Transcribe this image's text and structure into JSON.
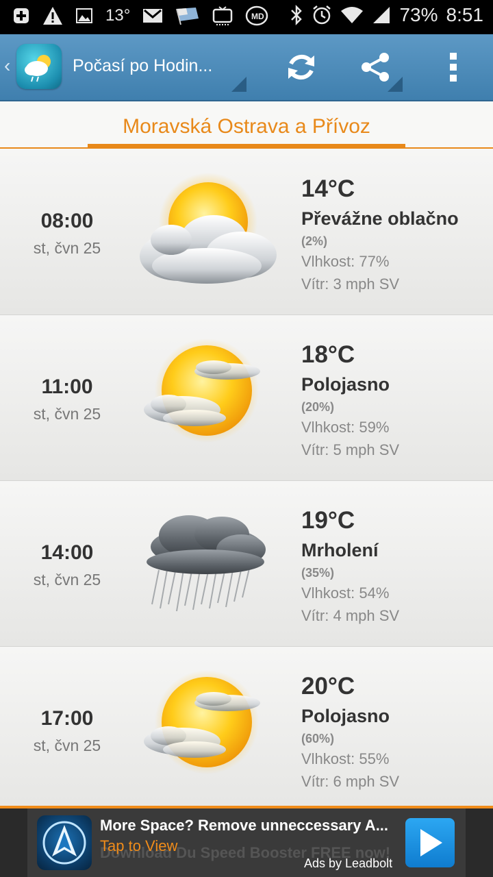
{
  "status_bar": {
    "left_icons": [
      "add-box-icon",
      "warning-icon",
      "image-icon",
      "mail-icon",
      "flag-icon",
      "tv-icon",
      "md-app-icon"
    ],
    "temperature": "13°",
    "right_icons": [
      "bluetooth-icon",
      "alarm-icon",
      "wifi-icon",
      "signal-icon"
    ],
    "battery": "73%",
    "time": "8:51"
  },
  "action_bar": {
    "title": "Počasí po Hodin...",
    "actions": [
      "refresh-icon",
      "share-icon",
      "overflow-menu-icon"
    ]
  },
  "location": {
    "name": "Moravská Ostrava a Přívoz"
  },
  "forecast": [
    {
      "time": "08:00",
      "date": "st, čvn 25",
      "icon": "mostly-cloudy-icon",
      "temp": "14°C",
      "condition": "Převážne oblačno",
      "precip": "(2%)",
      "humidity": "Vlhkost: 77%",
      "wind": "Vítr: 3 mph SV"
    },
    {
      "time": "11:00",
      "date": "st, čvn 25",
      "icon": "partly-cloudy-icon",
      "temp": "18°C",
      "condition": "Polojasno",
      "precip": "(20%)",
      "humidity": "Vlhkost: 59%",
      "wind": "Vítr: 5 mph SV"
    },
    {
      "time": "14:00",
      "date": "st, čvn 25",
      "icon": "drizzle-icon",
      "temp": "19°C",
      "condition": "Mrholení",
      "precip": "(35%)",
      "humidity": "Vlhkost: 54%",
      "wind": "Vítr: 4 mph SV"
    },
    {
      "time": "17:00",
      "date": "st, čvn 25",
      "icon": "partly-cloudy-icon",
      "temp": "20°C",
      "condition": "Polojasno",
      "precip": "(60%)",
      "humidity": "Vlhkost: 55%",
      "wind": "Vítr: 6 mph SV"
    }
  ],
  "ad": {
    "title": "More Space? Remove unneccessary A...",
    "subtitle": "Tap to View",
    "ghost_text": "Download Du Speed Booster FREE now!",
    "credit": "Ads by Leadbolt",
    "icon": "speed-booster-icon"
  },
  "colors": {
    "accent": "#e8891a",
    "action_bar": "#4a8ab8",
    "ad_button": "#1a90e0"
  }
}
